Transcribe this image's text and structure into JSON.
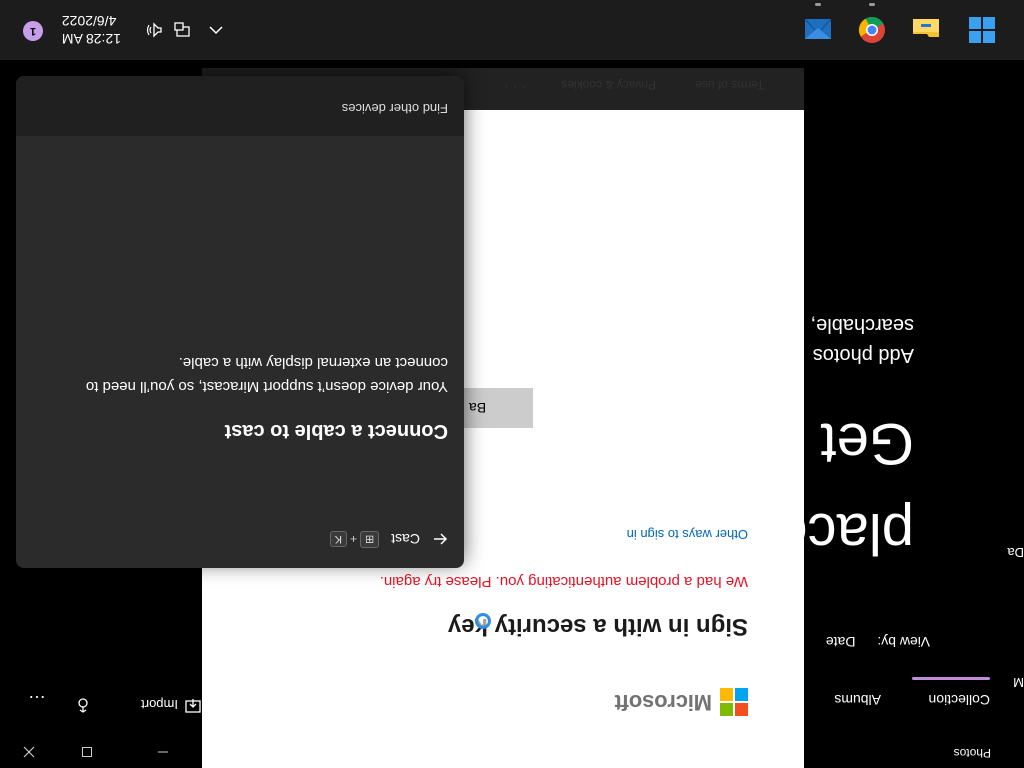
{
  "photos": {
    "app_title": "Photos",
    "tabs": [
      "Collection",
      "Albums"
    ],
    "tools": {
      "import_label": "Import",
      "more_label": "…"
    },
    "view_by_label": "View by:",
    "view_by_value": "Date",
    "hero_title": "Get a",
    "hero_title_line2": "place",
    "hero_sub_line1": "Add photos",
    "hero_sub_line2": "searchable,",
    "side_da": "Da",
    "side_m": "M",
    "back_button_label": "Ba"
  },
  "signin": {
    "brand": "Microsoft",
    "heading": "Sign in with a security key",
    "error_text": "We had a problem authenticating you. Please try again.",
    "other_ways_link": "Other ways to sign in",
    "footer": {
      "terms": "Terms of use",
      "privacy": "Privacy & cookies",
      "more": "· · ·"
    },
    "logo_colors": [
      "#f25022",
      "#7fba00",
      "#00a4ef",
      "#ffb900"
    ]
  },
  "cast": {
    "back_label": "←",
    "title_label": "Cast",
    "shortcut_key": "K",
    "heading": "Connect a cable to cast",
    "body": "Your device doesn’t support Miracast, so you’ll need to connect an external display with a cable.",
    "find_devices": "Find other devices"
  },
  "taskbar": {
    "time": "12:28 AM",
    "date": "4/6/2022",
    "notification_count": "1",
    "accent": "#c79ee8"
  }
}
